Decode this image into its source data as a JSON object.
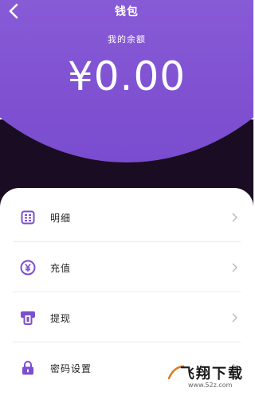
{
  "header": {
    "title": "钱包",
    "balance_label": "我的余额",
    "balance_amount": "¥0.00"
  },
  "menu": {
    "items": [
      {
        "label": "明细",
        "icon": "list-icon"
      },
      {
        "label": "充值",
        "icon": "yen-coin-icon"
      },
      {
        "label": "提现",
        "icon": "withdraw-card-icon"
      },
      {
        "label": "密码设置",
        "icon": "lock-icon"
      }
    ]
  },
  "watermark": {
    "text": "飞翔下载",
    "url": "www.52z.com"
  },
  "colors": {
    "accent": "#8b5ed8",
    "icon": "#7b4fd0",
    "dark_band": "#1a0c22"
  }
}
